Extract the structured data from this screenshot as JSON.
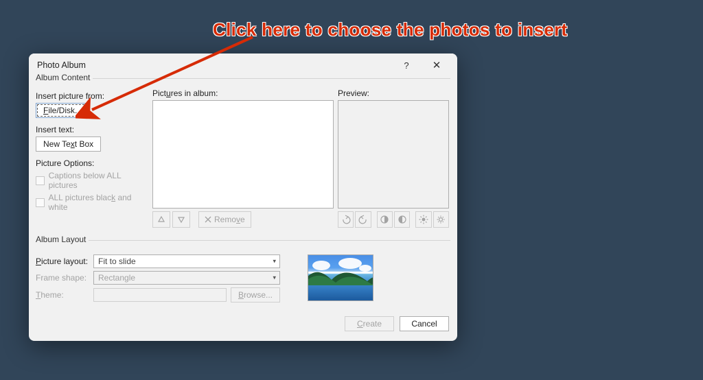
{
  "annotation": {
    "text": "Click here to choose the photos to insert"
  },
  "dialog": {
    "title": "Photo Album",
    "help_label": "?",
    "close_label": "✕"
  },
  "albumContent": {
    "section_label": "Album Content",
    "insert_picture_from_label": "Insert picture from:",
    "file_disk_btn": "File/Disk...",
    "insert_text_label": "Insert text:",
    "new_text_box_btn": "New Text Box",
    "picture_options_label": "Picture Options:",
    "captions_label": "Captions below ALL pictures",
    "bw_label": "ALL pictures black and white",
    "pictures_in_album_label": "Pictures in album:",
    "remove_label": "Remove",
    "preview_label": "Preview:"
  },
  "albumLayout": {
    "section_label": "Album Layout",
    "picture_layout_label": "Picture layout:",
    "picture_layout_value": "Fit to slide",
    "frame_shape_label": "Frame shape:",
    "frame_shape_value": "Rectangle",
    "theme_label": "Theme:",
    "browse_label": "Browse..."
  },
  "footer": {
    "create_label": "Create",
    "cancel_label": "Cancel"
  }
}
